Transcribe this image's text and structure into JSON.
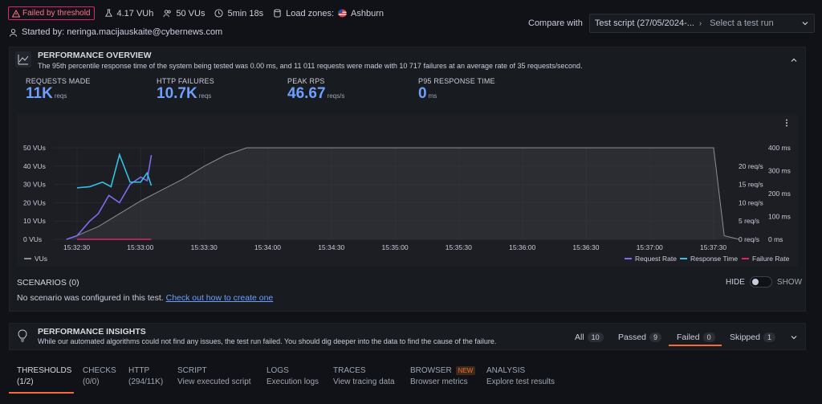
{
  "header": {
    "status_badge": "Failed by threshold",
    "vuh": "4.17 VUh",
    "vus": "50 VUs",
    "duration": "5min 18s",
    "load_zones_label": "Load zones:",
    "load_zone": "Ashburn",
    "started_by": "Started by: neringa.macijauskaite@cybernews.com",
    "compare_label": "Compare with",
    "compare_script": "Test script (27/05/2024-...",
    "compare_placeholder": "Select a test run"
  },
  "overview": {
    "title": "PERFORMANCE OVERVIEW",
    "summary": "The 95th percentile response time of the system being tested was 0.00 ms, and 11 011 requests were made with 10 717 failures at an average rate of 35 requests/second.",
    "stats": [
      {
        "label": "REQUESTS MADE",
        "value": "11K",
        "unit": "reqs"
      },
      {
        "label": "HTTP FAILURES",
        "value": "10.7K",
        "unit": "reqs"
      },
      {
        "label": "PEAK RPS",
        "value": "46.67",
        "unit": "reqs/s"
      },
      {
        "label": "P95 RESPONSE TIME",
        "value": "0",
        "unit": "ms"
      }
    ]
  },
  "chart_data": {
    "type": "line",
    "x_ticks": [
      "15:32:30",
      "15:33:00",
      "15:33:30",
      "15:34:00",
      "15:34:30",
      "15:35:00",
      "15:35:30",
      "15:36:00",
      "15:36:30",
      "15:37:00",
      "15:37:30"
    ],
    "y_left_ticks": [
      "0 VUs",
      "10 VUs",
      "20 VUs",
      "30 VUs",
      "40 VUs",
      "50 VUs"
    ],
    "y_right1_ticks": [
      "0 req/s",
      "5 req/s",
      "10 req/s",
      "15 req/s",
      "20 req/s"
    ],
    "y_right2_ticks": [
      "0 ms",
      "100 ms",
      "200 ms",
      "300 ms",
      "400 ms"
    ],
    "ylim_left": [
      0,
      50
    ],
    "ylim_rps": [
      0,
      25
    ],
    "ylim_ms": [
      0,
      400
    ],
    "series": [
      {
        "name": "VUs",
        "axis": "left",
        "color": "#8e8e8e",
        "x": [
          "15:32:25",
          "15:32:30",
          "15:32:40",
          "15:32:50",
          "15:33:00",
          "15:33:10",
          "15:33:20",
          "15:33:30",
          "15:33:40",
          "15:33:50",
          "15:37:20",
          "15:37:30",
          "15:37:35",
          "15:37:42"
        ],
        "y": [
          0,
          2,
          7,
          14,
          21,
          27,
          33,
          40,
          46,
          50,
          50,
          50,
          2,
          0
        ]
      },
      {
        "name": "Request Rate",
        "axis": "rps",
        "color": "#7c6cf2",
        "x": [
          "15:32:25",
          "15:32:30",
          "15:32:36",
          "15:32:40",
          "15:32:45",
          "15:32:50",
          "15:32:55",
          "15:33:00",
          "15:33:03",
          "15:33:05"
        ],
        "y": [
          0,
          1,
          5,
          7,
          12,
          10,
          15,
          17,
          16,
          23
        ]
      },
      {
        "name": "Response Time",
        "axis": "ms",
        "color": "#33c2e6",
        "x": [
          "15:32:30",
          "15:32:36",
          "15:32:42",
          "15:32:46",
          "15:32:50",
          "15:32:55",
          "15:33:00",
          "15:33:03",
          "15:33:05"
        ],
        "y": [
          225,
          230,
          250,
          230,
          370,
          250,
          250,
          290,
          235
        ]
      },
      {
        "name": "Failure Rate",
        "axis": "rps",
        "color": "#e0226e",
        "x": [
          "15:32:30",
          "15:33:05"
        ],
        "y": [
          0,
          0
        ]
      }
    ],
    "legend": [
      "Request Rate",
      "Response Time",
      "Failure Rate"
    ],
    "legend_left": "VUs",
    "legend_position": "bottom-right"
  },
  "scenarios": {
    "title": "SCENARIOS (0)",
    "hide": "HIDE",
    "show": "SHOW",
    "empty": "No scenario was configured in this test.",
    "link": "Check out how to create one"
  },
  "insights": {
    "title": "PERFORMANCE INSIGHTS",
    "text": "While our automated algorithms could not find any issues, the test run failed. You should dig deeper into the data to find the cause of the failure.",
    "filters": [
      {
        "label": "All",
        "count": "10"
      },
      {
        "label": "Passed",
        "count": "9"
      },
      {
        "label": "Failed",
        "count": "0"
      },
      {
        "label": "Skipped",
        "count": "1"
      }
    ]
  },
  "tabs": [
    {
      "title": "THRESHOLDS",
      "sub": "(1/2)"
    },
    {
      "title": "CHECKS",
      "sub": "(0/0)"
    },
    {
      "title": "HTTP",
      "sub": "(294/11K)"
    },
    {
      "title": "SCRIPT",
      "sub": "View executed script"
    },
    {
      "title": "LOGS",
      "sub": "Execution logs"
    },
    {
      "title": "TRACES",
      "sub": "View tracing data"
    },
    {
      "title": "BROWSER",
      "sub": "Browser metrics",
      "badge": "NEW"
    },
    {
      "title": "ANALYSIS",
      "sub": "Explore test results"
    }
  ],
  "colors": {
    "accent": "#6e9fff",
    "active_underline": "#f5683a",
    "failure": "#e0226e"
  }
}
